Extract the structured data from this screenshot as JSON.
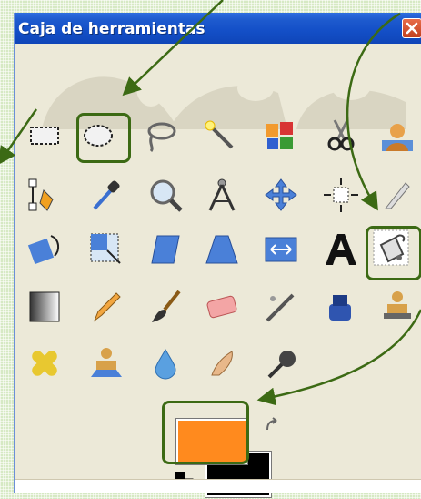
{
  "window": {
    "title": "Caja de herramientas",
    "close_label": "×"
  },
  "colors": {
    "foreground": "#ff8a1e",
    "background": "#000000",
    "highlight": "#3c6a14",
    "titlebar": "#1450c8"
  },
  "tools": [
    {
      "name": "rect-select-tool",
      "icon": "rect-select-icon"
    },
    {
      "name": "ellipse-select-tool",
      "icon": "ellipse-select-icon"
    },
    {
      "name": "free-select-tool",
      "icon": "lasso-icon"
    },
    {
      "name": "fuzzy-select-tool",
      "icon": "magic-wand-icon"
    },
    {
      "name": "color-select-tool",
      "icon": "color-select-icon"
    },
    {
      "name": "scissors-select-tool",
      "icon": "scissors-icon"
    },
    {
      "name": "foreground-select-tool",
      "icon": "foreground-select-icon"
    },
    {
      "name": "paths-tool",
      "icon": "paths-pen-icon"
    },
    {
      "name": "color-picker-tool",
      "icon": "eyedropper-icon"
    },
    {
      "name": "zoom-tool",
      "icon": "magnifier-icon"
    },
    {
      "name": "measure-tool",
      "icon": "compass-icon"
    },
    {
      "name": "move-tool",
      "icon": "move-arrows-icon"
    },
    {
      "name": "align-tool",
      "icon": "align-icon"
    },
    {
      "name": "crop-tool",
      "icon": "crop-knife-icon"
    },
    {
      "name": "rotate-tool",
      "icon": "rotate-icon"
    },
    {
      "name": "scale-tool",
      "icon": "scale-icon"
    },
    {
      "name": "shear-tool",
      "icon": "shear-icon"
    },
    {
      "name": "perspective-tool",
      "icon": "perspective-icon"
    },
    {
      "name": "flip-tool",
      "icon": "flip-icon"
    },
    {
      "name": "text-tool",
      "icon": "text-a-icon"
    },
    {
      "name": "bucket-fill-tool",
      "icon": "paint-bucket-icon"
    },
    {
      "name": "blend-tool",
      "icon": "gradient-icon"
    },
    {
      "name": "pencil-tool",
      "icon": "pencil-icon"
    },
    {
      "name": "paintbrush-tool",
      "icon": "paintbrush-icon"
    },
    {
      "name": "eraser-tool",
      "icon": "eraser-icon"
    },
    {
      "name": "airbrush-tool",
      "icon": "airbrush-icon"
    },
    {
      "name": "ink-tool",
      "icon": "ink-pot-icon"
    },
    {
      "name": "clone-tool",
      "icon": "clone-stamp-icon"
    },
    {
      "name": "heal-tool",
      "icon": "bandage-icon"
    },
    {
      "name": "perspective-clone-tool",
      "icon": "perspective-clone-icon"
    },
    {
      "name": "blur-sharpen-tool",
      "icon": "water-drop-icon"
    },
    {
      "name": "smudge-tool",
      "icon": "smudge-finger-icon"
    },
    {
      "name": "dodge-burn-tool",
      "icon": "dodge-burn-icon"
    }
  ]
}
